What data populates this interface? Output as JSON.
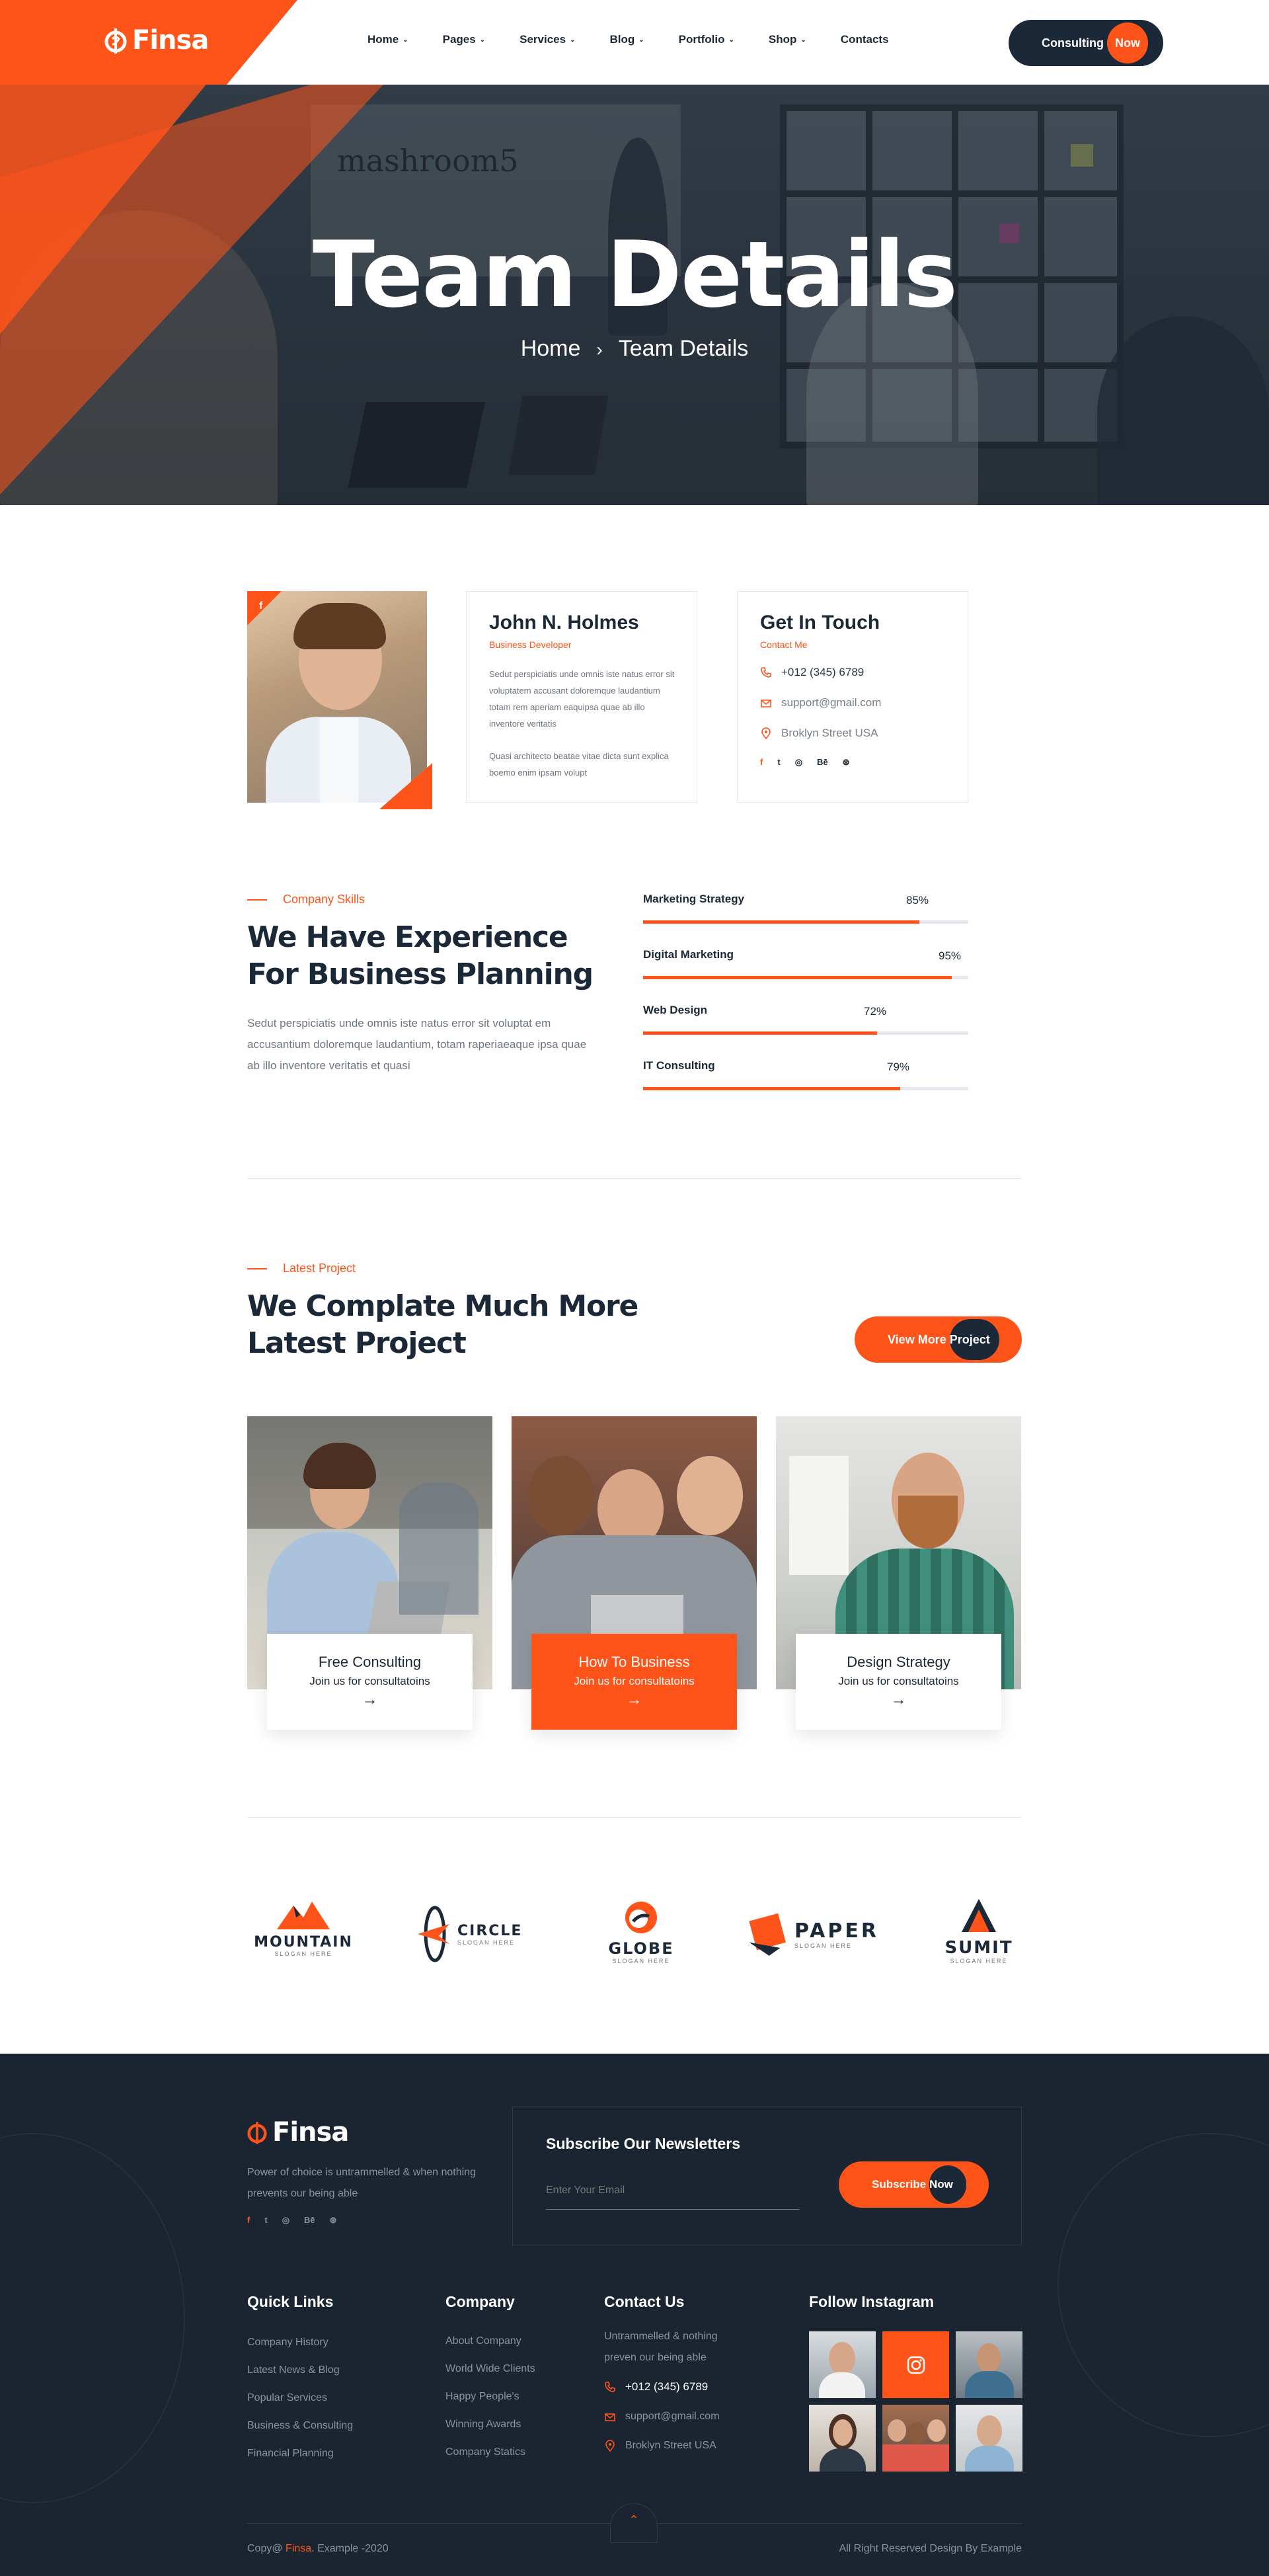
{
  "colors": {
    "accent": "#ff5419",
    "dark": "#1b2837",
    "footer_bg": "#1a2531"
  },
  "header": {
    "logo": "Finsa",
    "nav": [
      {
        "label": "Home",
        "has_dropdown": true
      },
      {
        "label": "Pages",
        "has_dropdown": true
      },
      {
        "label": "Services",
        "has_dropdown": true
      },
      {
        "label": "Blog",
        "has_dropdown": true
      },
      {
        "label": "Portfolio",
        "has_dropdown": true
      },
      {
        "label": "Shop",
        "has_dropdown": true
      },
      {
        "label": "Contacts",
        "has_dropdown": false
      }
    ],
    "cta_a": "Consulting",
    "cta_b": "Now"
  },
  "hero": {
    "board_text": "mashroom5",
    "title": "Team Details",
    "crumb_home": "Home",
    "crumb_sep": "›",
    "crumb_current": "Team Details"
  },
  "member": {
    "name": "John N. Holmes",
    "role": "Business Developer",
    "bio_1": "Sedut perspiciatis unde omnis iste natus error sit voluptatem accusant doloremque laudantium totam rem aperiam eaquipsa quae ab illo inventore veritatis",
    "bio_2": "Quasi architecto beatae vitae dicta sunt explica boemo enim ipsam volupt",
    "photo_social": "f"
  },
  "contact": {
    "title": "Get In Touch",
    "sub": "Contact Me",
    "phone": "+012 (345) 6789",
    "email": "support@gmail.com",
    "address": "Broklyn Street USA",
    "social": [
      "f",
      "t",
      "◎",
      "Bē",
      "⊛"
    ]
  },
  "skills": {
    "eyebrow": "Company Skills",
    "title_1": "We Have Experience",
    "title_2": "For Business Planning",
    "text": "Sedut perspiciatis unde omnis iste natus error sit voluptat em accusantium doloremque laudantium, totam raperiaeaque ipsa quae ab illo inventore veritatis et quasi",
    "bars": [
      {
        "label": "Marketing Strategy",
        "pct_label": "85%",
        "value": 0.85
      },
      {
        "label": "Digital Marketing",
        "pct_label": "95%",
        "value": 0.95
      },
      {
        "label": "Web Design",
        "pct_label": "72%",
        "value": 0.72
      },
      {
        "label": "IT Consulting",
        "pct_label": "79%",
        "value": 0.79
      }
    ]
  },
  "projects": {
    "eyebrow": "Latest Project",
    "title_1": "We Complate Much More",
    "title_2": "Latest Project",
    "btn_a": "View More",
    "btn_b": "Project",
    "items": [
      {
        "title": "Free Consulting",
        "sub": "Join us for consultatoins",
        "active": false
      },
      {
        "title": "How To Business",
        "sub": "Join us for consultatoins",
        "active": true
      },
      {
        "title": "Design Strategy",
        "sub": "Join us for consultatoins",
        "active": false
      }
    ]
  },
  "brands": [
    {
      "name": "MOUNTAIN",
      "slogan": "SLOGAN HERE"
    },
    {
      "name": "CIRCLE",
      "slogan": "SLOGAN HERE"
    },
    {
      "name": "GLOBE",
      "slogan": "SLOGAN HERE"
    },
    {
      "name": "PAPER",
      "slogan": "SLOGAN HERE"
    },
    {
      "name": "SUMIT",
      "slogan": "SLOGAN HERE"
    }
  ],
  "footer": {
    "logo": "Finsa",
    "about": "Power of choice is untrammelled & when nothing prevents our being able",
    "social": [
      "f",
      "t",
      "◎",
      "Bē",
      "⊛"
    ],
    "newsletter_title": "Subscribe Our Newsletters",
    "email_placeholder": "Enter Your Email",
    "subscribe_a": "Subscribe",
    "subscribe_b": "Now",
    "quick_links_title": "Quick Links",
    "quick_links": [
      "Company History",
      "Latest News & Blog",
      "Popular Services",
      "Business & Consulting",
      "Financial Planning"
    ],
    "company_title": "Company",
    "company_links": [
      "About Company",
      "World Wide Clients",
      "Happy People's",
      "Winning Awards",
      "Company Statics"
    ],
    "contact_title": "Contact Us",
    "contact_text": "Untrammelled & nothing preven our being able",
    "phone": "+012 (345) 6789",
    "email": "support@gmail.com",
    "address": "Broklyn Street USA",
    "instagram_title": "Follow Instagram",
    "copyright_pre": "Copy@",
    "copyright_brand": "Finsa",
    "copyright_post": ". Example -2020",
    "rights": "All Right Reserved Design By Example"
  }
}
